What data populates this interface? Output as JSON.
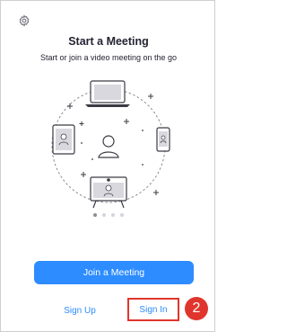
{
  "header": {
    "settings_icon": "gear-icon"
  },
  "main": {
    "title": "Start a Meeting",
    "subtitle": "Start or join a video meeting on the go"
  },
  "carousel": {
    "page_count": 4,
    "active_index": 0
  },
  "actions": {
    "join_label": "Join a Meeting",
    "signup_label": "Sign Up",
    "signin_label": "Sign In"
  },
  "annotation": {
    "step_number": "2"
  },
  "colors": {
    "accent": "#2d8cff",
    "highlight": "#e0352d",
    "text": "#232333"
  }
}
